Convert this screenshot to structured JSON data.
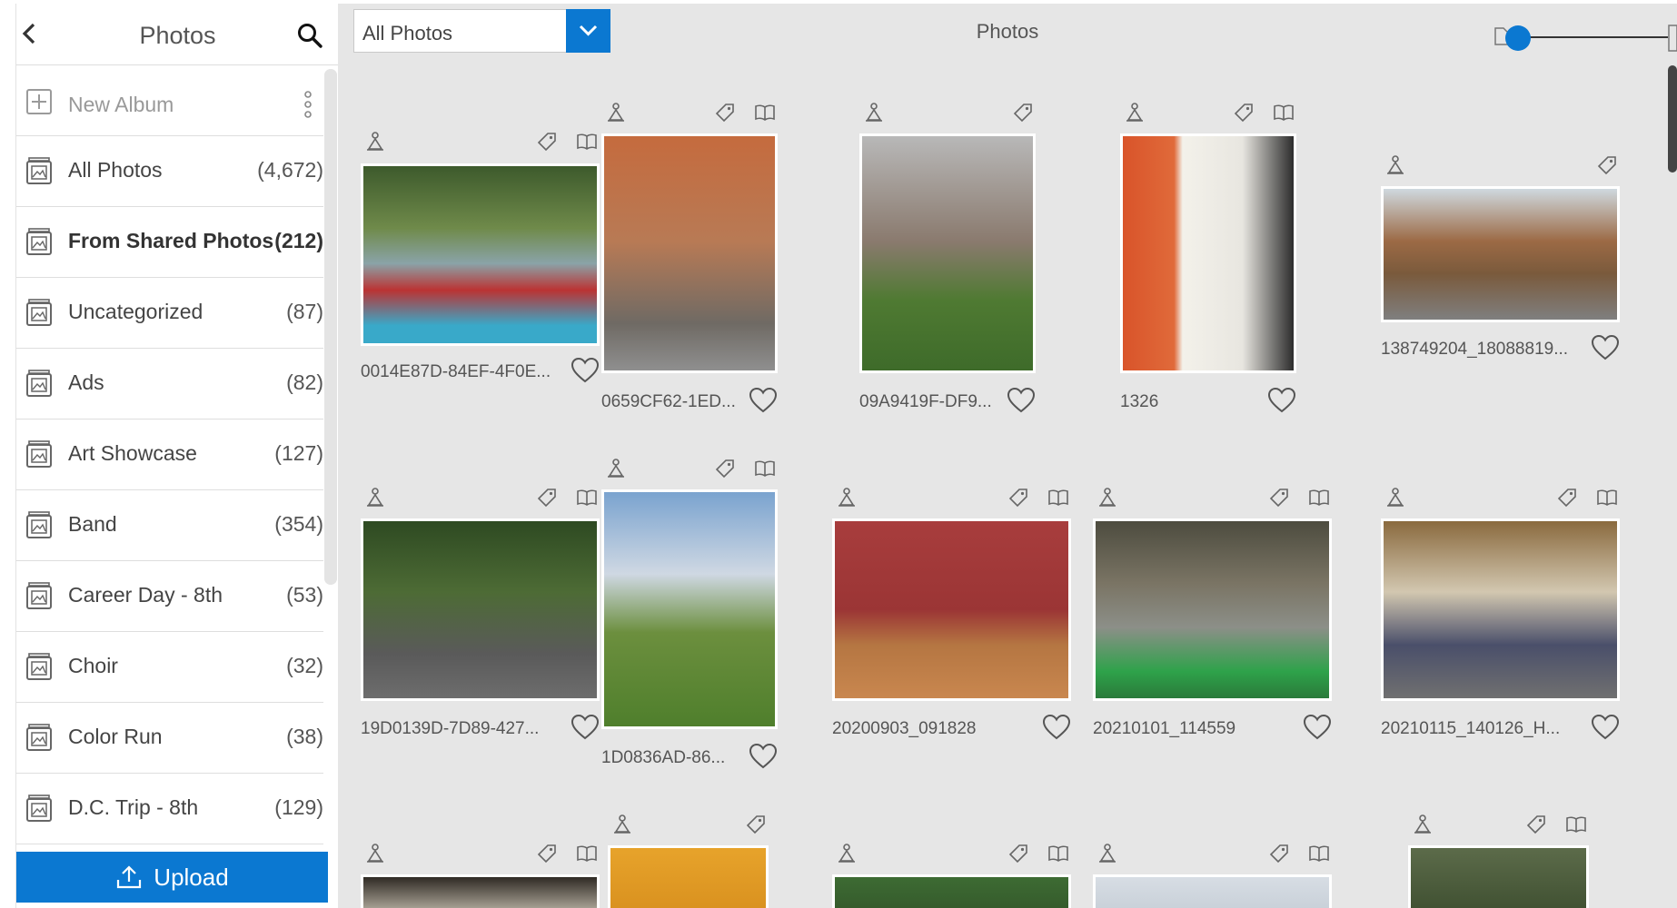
{
  "sidebar": {
    "title": "Photos",
    "new_album_label": "New Album",
    "albums": [
      {
        "label": "All Photos",
        "count": "(4,672)"
      },
      {
        "label": "From Shared Photos",
        "count": "(212)"
      },
      {
        "label": "Uncategorized",
        "count": "(87)"
      },
      {
        "label": "Ads",
        "count": "(82)"
      },
      {
        "label": "Art Showcase",
        "count": "(127)"
      },
      {
        "label": "Band",
        "count": "(354)"
      },
      {
        "label": "Career Day - 8th",
        "count": "(53)"
      },
      {
        "label": "Choir",
        "count": "(32)"
      },
      {
        "label": "Color Run",
        "count": "(38)"
      },
      {
        "label": "D.C. Trip - 8th",
        "count": "(129)"
      }
    ],
    "active_album": "From Shared Photos",
    "upload_label": "Upload"
  },
  "topbar": {
    "filter_value": "All Photos",
    "title": "Photos"
  },
  "photos": [
    {
      "name": "0014E87D-84EF-4F0E...",
      "tools": [
        "person",
        "tag",
        "book"
      ]
    },
    {
      "name": "0659CF62-1ED...",
      "tools": [
        "person",
        "tag",
        "book"
      ]
    },
    {
      "name": "09A9419F-DF9...",
      "tools": [
        "person",
        "tag"
      ]
    },
    {
      "name": "1326",
      "tools": [
        "person",
        "tag",
        "book"
      ]
    },
    {
      "name": "138749204_18088819...",
      "tools": [
        "person",
        "tag"
      ]
    },
    {
      "name": "19D0139D-7D89-427...",
      "tools": [
        "person",
        "tag",
        "book"
      ]
    },
    {
      "name": "1D0836AD-86...",
      "tools": [
        "person",
        "tag",
        "book"
      ]
    },
    {
      "name": "20200903_091828",
      "tools": [
        "person",
        "tag",
        "book"
      ]
    },
    {
      "name": "20210101_114559",
      "tools": [
        "person",
        "tag",
        "book"
      ]
    },
    {
      "name": "20210115_140126_H...",
      "tools": [
        "person",
        "tag",
        "book"
      ]
    },
    {
      "name": "",
      "tools": [
        "person",
        "tag",
        "book"
      ]
    },
    {
      "name": "",
      "tools": [
        "person",
        "tag"
      ]
    },
    {
      "name": "",
      "tools": [
        "person",
        "tag",
        "book"
      ]
    },
    {
      "name": "",
      "tools": [
        "person",
        "tag",
        "book"
      ]
    },
    {
      "name": "",
      "tools": [
        "person",
        "tag",
        "book"
      ]
    }
  ],
  "colors": {
    "accent": "#0b78d1",
    "grid_background": "#e6e6e6",
    "sidebar_background": "#ffffff"
  }
}
